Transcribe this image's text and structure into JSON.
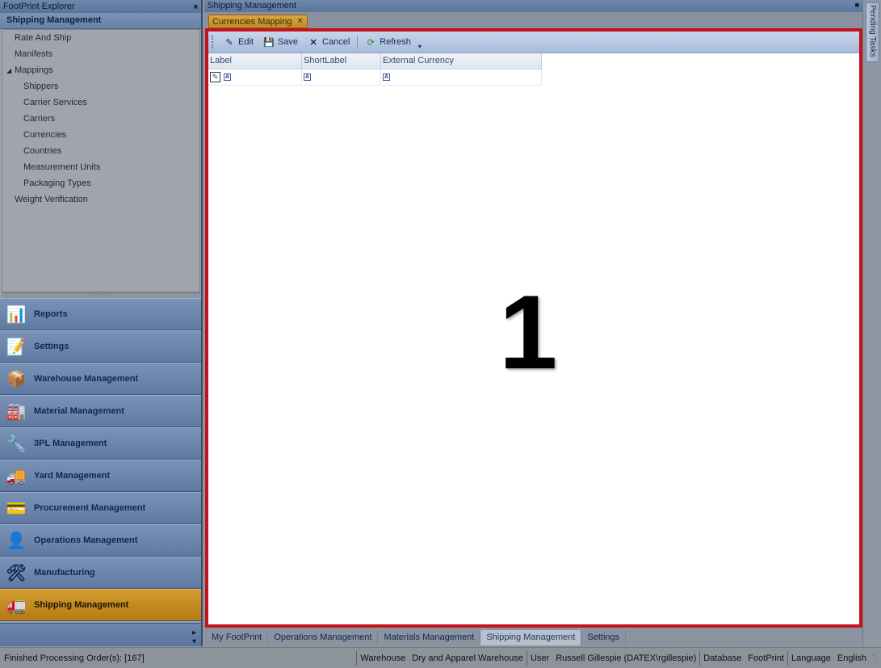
{
  "explorer": {
    "title": "FootPrint Explorer",
    "section": "Shipping Management",
    "tree": [
      {
        "label": "Rate And Ship",
        "level": 0
      },
      {
        "label": "Manifests",
        "level": 0
      },
      {
        "label": "Mappings",
        "level": 0,
        "expanded": true
      },
      {
        "label": "Shippers",
        "level": 1
      },
      {
        "label": "Carrier Services",
        "level": 1
      },
      {
        "label": "Carriers",
        "level": 1
      },
      {
        "label": "Currencies",
        "level": 1
      },
      {
        "label": "Countries",
        "level": 1
      },
      {
        "label": "Measurement Units",
        "level": 1
      },
      {
        "label": "Packaging Types",
        "level": 1
      },
      {
        "label": "Weight Verification",
        "level": 0
      }
    ],
    "modules": [
      {
        "label": "Reports",
        "icon": "reports-icon"
      },
      {
        "label": "Settings",
        "icon": "settings-icon"
      },
      {
        "label": "Warehouse Management",
        "icon": "warehouse-icon"
      },
      {
        "label": "Material Management",
        "icon": "material-icon"
      },
      {
        "label": "3PL Management",
        "icon": "3pl-icon"
      },
      {
        "label": "Yard Management",
        "icon": "yard-icon"
      },
      {
        "label": "Procurement Management",
        "icon": "procurement-icon"
      },
      {
        "label": "Operations Management",
        "icon": "operations-icon"
      },
      {
        "label": "Manufacturing",
        "icon": "manufacturing-icon"
      },
      {
        "label": "Shipping Management",
        "icon": "shipping-icon",
        "active": true
      }
    ]
  },
  "main": {
    "title": "Shipping Management",
    "tab_label": "Currencies Mapping",
    "toolbar": {
      "edit": "Edit",
      "save": "Save",
      "cancel": "Cancel",
      "refresh": "Refresh"
    },
    "grid": {
      "columns": [
        "Label",
        "ShortLabel",
        "External Currency"
      ]
    },
    "overlay_number": "1"
  },
  "pending_tasks": "Pending Tasks",
  "bottom_tabs": [
    {
      "label": "My FootPrint"
    },
    {
      "label": "Operations Management"
    },
    {
      "label": "Materials Management"
    },
    {
      "label": "Shipping Management",
      "active": true
    },
    {
      "label": "Settings"
    }
  ],
  "status": {
    "message": "Finished Processing Order(s): [167]",
    "warehouse_label": "Warehouse",
    "warehouse_value": "Dry and Apparel Warehouse",
    "user_label": "User",
    "user_value": "Russell Gillespie (DATEX\\rgillespie)",
    "database_label": "Database",
    "database_value": "FootPrint",
    "language_label": "Language",
    "language_value": "English"
  },
  "colors": {
    "highlight_border": "#c4131b",
    "active_module": "#c48a22",
    "nav_blue": "#6882a8"
  }
}
